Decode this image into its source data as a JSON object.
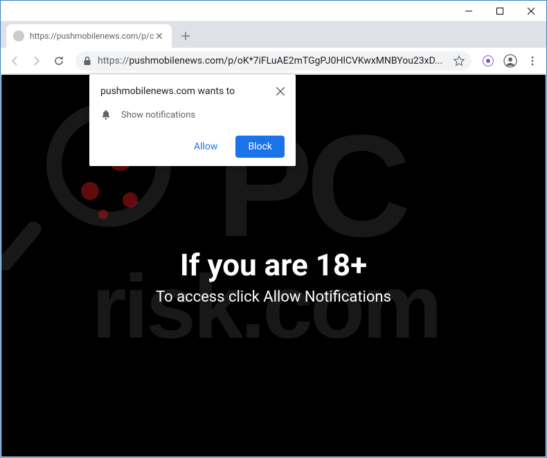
{
  "window": {
    "tab_title": "https://pushmobilenews.com/p/c",
    "url_scheme": "https://",
    "url_rest": "pushmobilenews.com/p/oK*7iFLuAE2mTGgPJ0HlCVKwxMNBYou23xD..."
  },
  "permission": {
    "title": "pushmobilenews.com wants to",
    "option_label": "Show notifications",
    "allow_label": "Allow",
    "block_label": "Block"
  },
  "page": {
    "headline": "If you are 18+",
    "subline": "To access click Allow Notifications"
  },
  "watermark": {
    "pc_text": "PC",
    "risk_text": "risk.com"
  }
}
